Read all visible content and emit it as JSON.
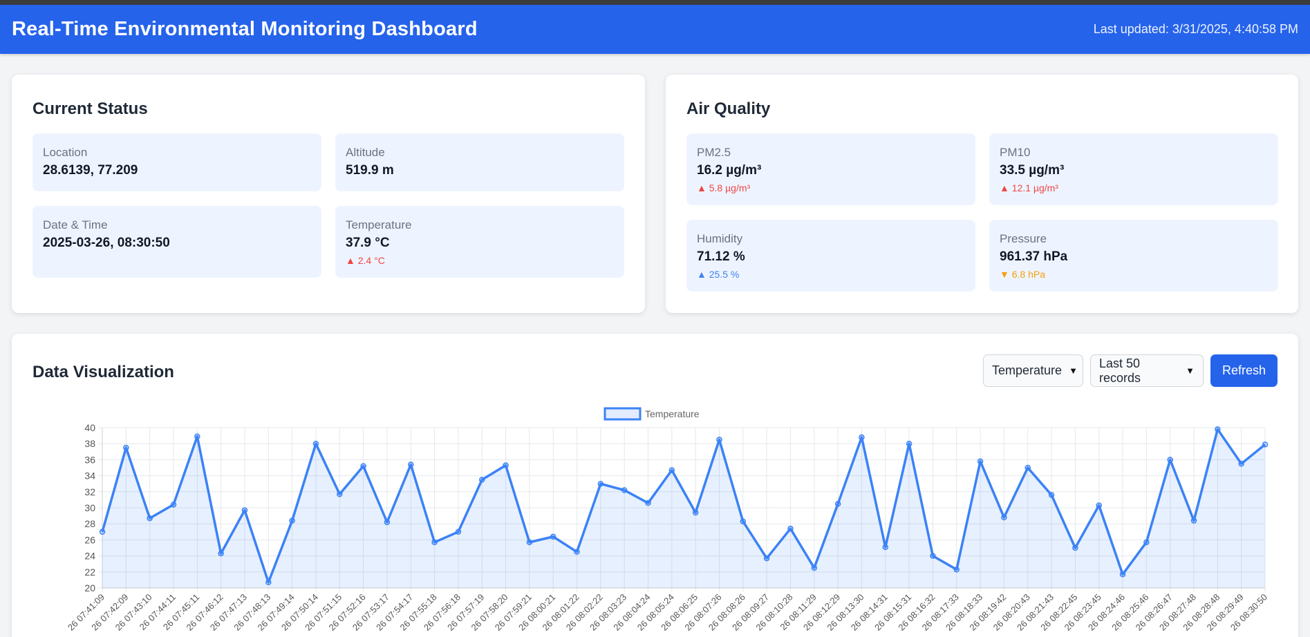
{
  "header": {
    "title": "Real-Time Environmental Monitoring Dashboard",
    "last_updated": "Last updated: 3/31/2025, 4:40:58 PM"
  },
  "current_status": {
    "title": "Current Status",
    "location": {
      "label": "Location",
      "value": "28.6139, 77.209"
    },
    "altitude": {
      "label": "Altitude",
      "value": "519.9 m"
    },
    "datetime": {
      "label": "Date & Time",
      "value": "2025-03-26, 08:30:50"
    },
    "temperature": {
      "label": "Temperature",
      "value": "37.9 °C",
      "change": "▲ 2.4 °C"
    }
  },
  "air_quality": {
    "title": "Air Quality",
    "pm25": {
      "label": "PM2.5",
      "value": "16.2 µg/m³",
      "change": "▲ 5.8 µg/m³"
    },
    "pm10": {
      "label": "PM10",
      "value": "33.5 µg/m³",
      "change": "▲ 12.1 µg/m³"
    },
    "humidity": {
      "label": "Humidity",
      "value": "71.12 %",
      "change": "▲ 25.5 %"
    },
    "pressure": {
      "label": "Pressure",
      "value": "961.37 hPa",
      "change": "▼ 6.8 hPa"
    }
  },
  "visualization": {
    "title": "Data Visualization",
    "metric_select": "Temperature",
    "range_select": "Last 50 records",
    "refresh_label": "Refresh"
  },
  "colors": {
    "primary": "#2563eb",
    "line": "#3b82f6",
    "fill": "rgba(59,130,246,0.12)",
    "up_red": "#ef4444",
    "up_blue": "#3b82f6",
    "down_amber": "#f59e0b"
  },
  "chart_data": {
    "type": "line",
    "legend": "Temperature",
    "legend_position": "top-center",
    "grid": true,
    "ylim": [
      20,
      40
    ],
    "ytick_step": 2,
    "x": [
      "26 07:41:09",
      "26 07:42:09",
      "26 07:43:10",
      "26 07:44:11",
      "26 07:45:11",
      "26 07:46:12",
      "26 07:47:13",
      "26 07:48:13",
      "26 07:49:14",
      "26 07:50:14",
      "26 07:51:15",
      "26 07:52:16",
      "26 07:53:17",
      "26 07:54:17",
      "26 07:55:18",
      "26 07:56:18",
      "26 07:57:19",
      "26 07:58:20",
      "26 07:59:21",
      "26 08:00:21",
      "26 08:01:22",
      "26 08:02:22",
      "26 08:03:23",
      "26 08:04:24",
      "26 08:05:24",
      "26 08:06:25",
      "26 08:07:26",
      "26 08:08:26",
      "26 08:09:27",
      "26 08:10:28",
      "26 08:11:29",
      "26 08:12:29",
      "26 08:13:30",
      "26 08:14:31",
      "26 08:15:31",
      "26 08:16:32",
      "26 08:17:33",
      "26 08:18:33",
      "26 08:19:42",
      "26 08:20:43",
      "26 08:21:43",
      "26 08:22:45",
      "26 08:23:45",
      "26 08:24:46",
      "26 08:25:46",
      "26 08:26:47",
      "26 08:27:48",
      "26 08:28:48",
      "26 08:29:49",
      "26 08:30:50"
    ],
    "series": [
      {
        "name": "Temperature",
        "values": [
          27.0,
          37.5,
          28.7,
          30.4,
          38.9,
          24.3,
          29.7,
          20.7,
          28.4,
          38.0,
          31.7,
          35.2,
          28.2,
          35.4,
          25.7,
          27.0,
          33.5,
          35.3,
          25.7,
          26.4,
          24.5,
          33.0,
          32.2,
          30.6,
          34.7,
          29.4,
          38.5,
          28.3,
          23.7,
          27.4,
          22.5,
          30.5,
          38.8,
          25.1,
          38.0,
          24.0,
          22.3,
          35.8,
          28.8,
          35.0,
          31.6,
          25.0,
          30.3,
          21.7,
          25.7,
          36.0,
          28.4,
          39.8,
          35.5,
          37.9
        ]
      }
    ]
  }
}
